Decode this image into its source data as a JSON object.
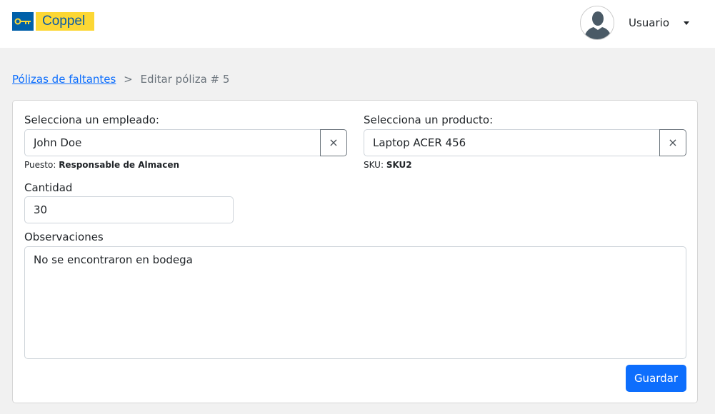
{
  "header": {
    "logo_text": "Coppel",
    "user_name": "Usuario"
  },
  "breadcrumb": {
    "parent": "Pólizas de faltantes",
    "separator": ">",
    "current": "Editar póliza # 5"
  },
  "form": {
    "employee_label": "Selecciona un empleado:",
    "employee_value": "John Doe",
    "puesto_label": "Puesto:",
    "puesto_value": "Responsable de Almacen",
    "product_label": "Selecciona un producto:",
    "product_value": "Laptop ACER 456",
    "sku_label": "SKU:",
    "sku_value": "SKU2",
    "clear_icon": "×",
    "quantity_label": "Cantidad",
    "quantity_value": "30",
    "notes_label": "Observaciones",
    "notes_value": "No se encontraron en bodega",
    "save_label": "Guardar"
  }
}
